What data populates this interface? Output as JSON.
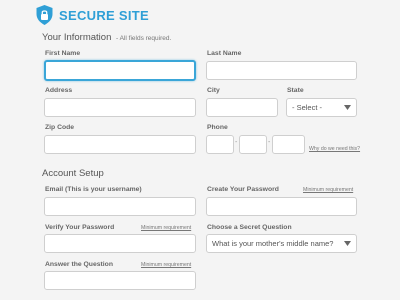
{
  "header": {
    "brand": "SECURE SITE",
    "colors": {
      "accent": "#2f9fd6"
    },
    "icon": "shield-lock-icon"
  },
  "info_section": {
    "title": "Your Information",
    "note": "- All fields required.",
    "first_name_label": "First Name",
    "last_name_label": "Last Name",
    "address_label": "Address",
    "city_label": "City",
    "state_label": "State",
    "state_value": "- Select -",
    "zip_label": "Zip Code",
    "phone_label": "Phone",
    "phone_link": "Why do we need this?"
  },
  "account_section": {
    "title": "Account Setup",
    "email_label": "Email (This is your username)",
    "create_password_label": "Create Your Password",
    "create_password_hint": "Minimum requirement",
    "verify_password_label": "Verify Your Password",
    "verify_password_hint": "Minimum requirement",
    "secret_question_label": "Choose a Secret Question",
    "secret_question_value": "What is your mother's middle name?",
    "answer_label": "Answer the Question",
    "answer_hint": "Minimum requirement"
  }
}
